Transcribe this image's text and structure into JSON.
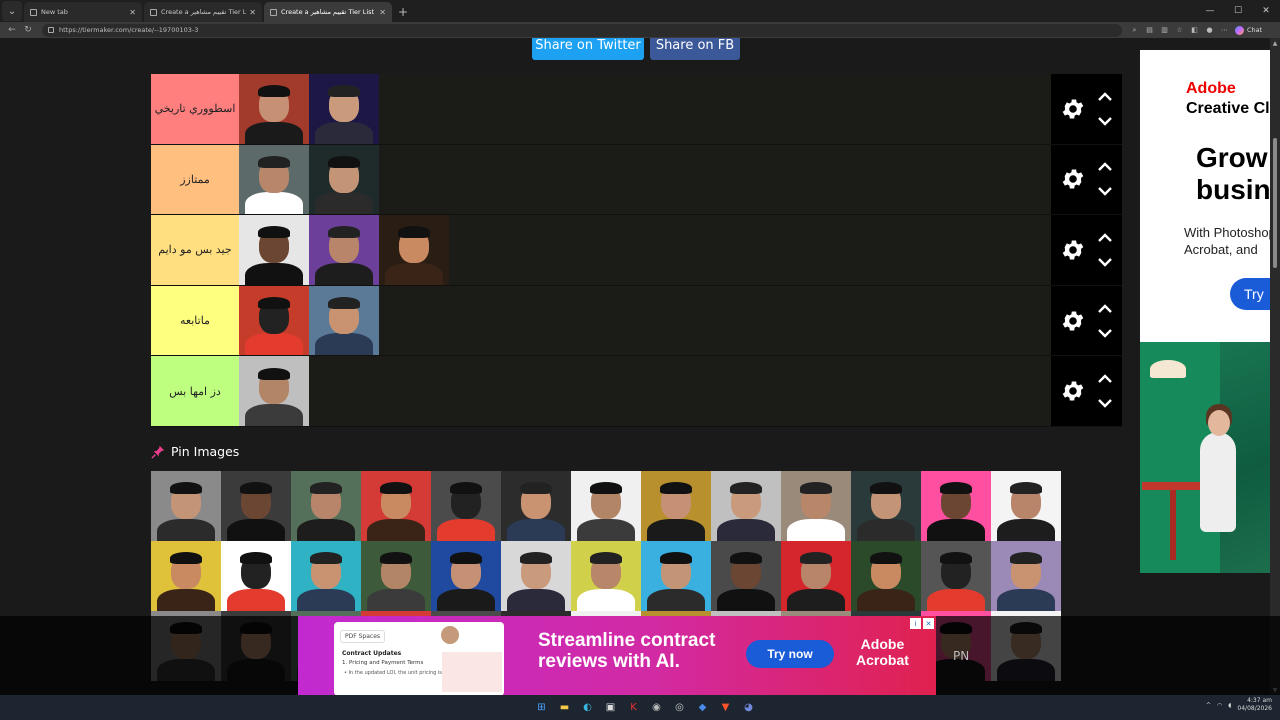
{
  "browser": {
    "tabs": [
      {
        "label": "New tab",
        "active": false
      },
      {
        "label": "Create a تقييم مشاهير Tier List - TierMaker",
        "active": false
      },
      {
        "label": "Create a تقييم مشاهير Tier List - TierMaker",
        "active": true
      }
    ],
    "url": "https://tiermaker.com/create/--19700103-3",
    "chat_label": "Chat"
  },
  "share": {
    "twitter": "Share on Twitter",
    "facebook": "Share on FB"
  },
  "tiers": [
    {
      "label": "اسطووري تاريخي",
      "color": "#ff7f7f",
      "item_count": 2
    },
    {
      "label": "ممتازز",
      "color": "#ffbf7f",
      "item_count": 2
    },
    {
      "label": "جيد بس مو دايم",
      "color": "#ffdf7f",
      "item_count": 3
    },
    {
      "label": "ماتابعه",
      "color": "#ffff7f",
      "item_count": 2
    },
    {
      "label": "دز امها بس",
      "color": "#bfff7f",
      "item_count": 1
    }
  ],
  "pin": {
    "title": "Pin Images"
  },
  "side_ad": {
    "brand": "Adobe",
    "sub": "Creative Cloud",
    "headline_1": "Grow",
    "headline_2": "business",
    "body_1": "With Photoshop,",
    "body_2": "Acrobat, and",
    "cta": "Try"
  },
  "bottom_ad": {
    "doc_tag": "PDF Spaces",
    "doc_heading": "Contract Updates",
    "doc_line_1": "1. Pricing and Payment Terms",
    "doc_line_2": "• In the updated LOI, the unit pricing is",
    "headline_1": "Streamline contract",
    "headline_2": "reviews with AI.",
    "cta": "Try now",
    "logo_1": "Adobe",
    "logo_2": "Acrobat"
  },
  "pn_text": "PN",
  "taskbar": {
    "time": "4:37 am",
    "date": "04/08/2026"
  },
  "colors": {
    "accent_twitter": "#1da1f2",
    "accent_facebook": "#3b5998",
    "pin_color": "#e83e8c"
  }
}
